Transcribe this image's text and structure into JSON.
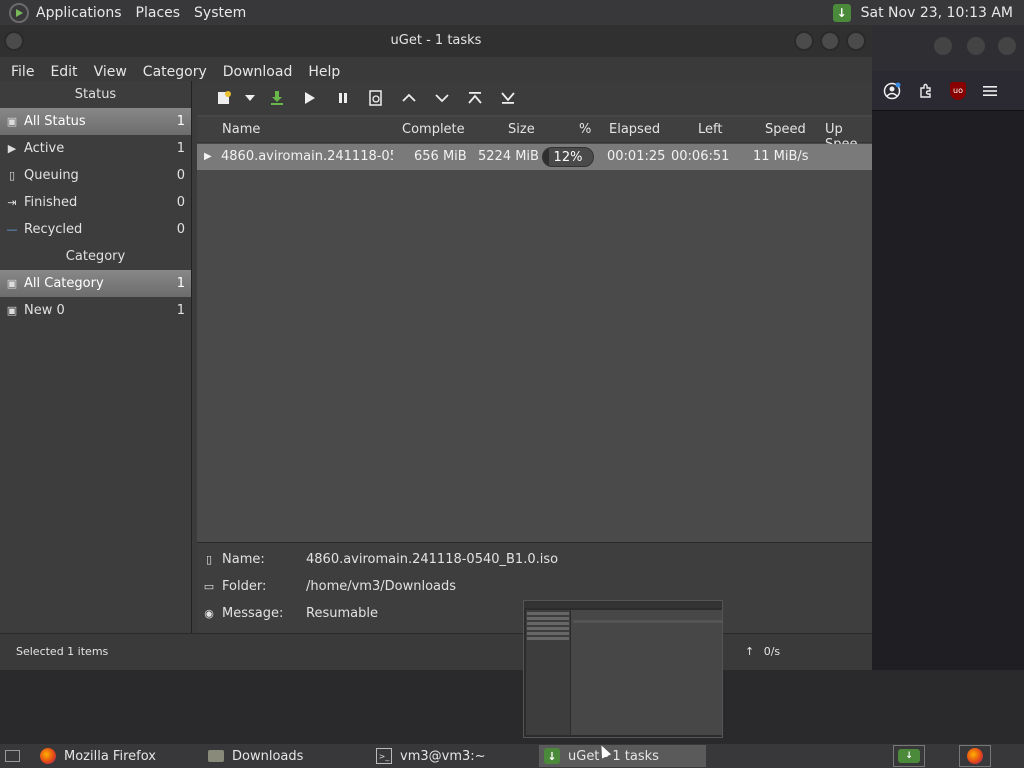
{
  "top_panel": {
    "menu": [
      "Applications",
      "Places",
      "System"
    ],
    "clock": "Sat Nov 23, 10:13 AM",
    "tray_icon": "uget-tray-icon"
  },
  "window": {
    "title": "uGet - 1 tasks",
    "menu": [
      "File",
      "Edit",
      "View",
      "Category",
      "Download",
      "Help"
    ]
  },
  "sidebar": {
    "status_header": "Status",
    "status_items": [
      {
        "label": "All Status",
        "count": "1",
        "icon": "all-status-icon"
      },
      {
        "label": "Active",
        "count": "1",
        "icon": "play-icon"
      },
      {
        "label": "Queuing",
        "count": "0",
        "icon": "document-icon"
      },
      {
        "label": "Finished",
        "count": "0",
        "icon": "finished-icon"
      },
      {
        "label": "Recycled",
        "count": "0",
        "icon": "recycled-icon"
      }
    ],
    "category_header": "Category",
    "category_items": [
      {
        "label": "All Category",
        "count": "1"
      },
      {
        "label": "New 0",
        "count": "1"
      }
    ]
  },
  "columns": [
    "Name",
    "Complete",
    "Size",
    "%",
    "Elapsed",
    "Left",
    "Speed",
    "Up Spee"
  ],
  "downloads": [
    {
      "name": "4860.aviromain.241118-0540",
      "complete": "656 MiB",
      "size": "5224 MiB",
      "percent": "12%",
      "progress": 0.12,
      "elapsed": "00:01:25",
      "left": "00:06:51",
      "speed": "11 MiB/s"
    }
  ],
  "details": {
    "name_label": "Name:",
    "name_value": "4860.aviromain.241118-0540_B1.0.iso",
    "folder_label": "Folder:",
    "folder_value": "/home/vm3/Downloads",
    "message_label": "Message:",
    "message_value": "Resumable"
  },
  "statusbar": {
    "selected": "Selected 1 items",
    "up_speed": "0/s",
    "up_arrow": "↑"
  },
  "taskbar": {
    "tasks": [
      {
        "label": "Mozilla Firefox",
        "icon": "firefox-icon"
      },
      {
        "label": "Downloads",
        "icon": "folder-icon"
      },
      {
        "label": "vm3@vm3:~",
        "icon": "terminal-icon"
      },
      {
        "label": "uGet - 1 tasks",
        "icon": "uget-icon"
      }
    ]
  },
  "colors": {
    "uget_green": "#4a8a3a",
    "selection": "#7a7a7a",
    "panel": "#38383a"
  }
}
